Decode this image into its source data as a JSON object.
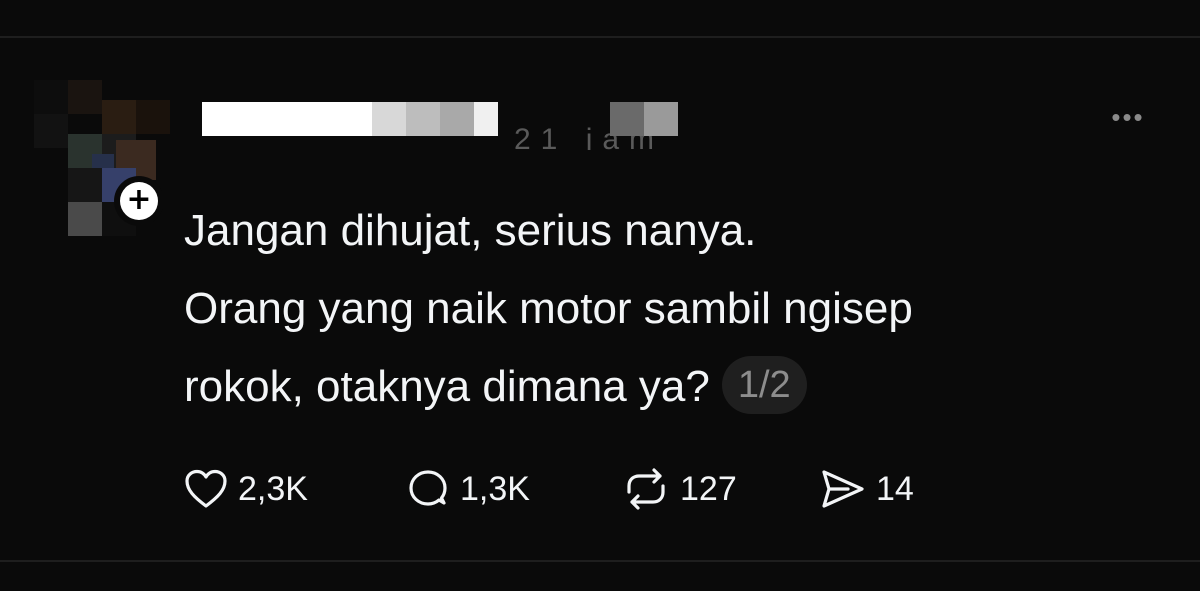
{
  "post": {
    "lines": [
      "Jangan dihujat, serius nanya.",
      "Orang yang naik motor sambil ngisep",
      "rokok, otaknya dimana ya?"
    ],
    "page_indicator": "1/2"
  },
  "author": {
    "follow_symbol": "+"
  },
  "menu": {
    "more_symbol": "•••"
  },
  "actions": {
    "like": {
      "icon": "heart-icon",
      "count": "2,3K"
    },
    "reply": {
      "icon": "comment-icon",
      "count": "1,3K"
    },
    "repost": {
      "icon": "repost-icon",
      "count": "127"
    },
    "share": {
      "icon": "send-icon",
      "count": "14"
    }
  },
  "colors": {
    "background": "#0a0a0a",
    "text": "#f3f5f7",
    "muted": "#8d8d8d",
    "pill_bg": "#1f1f1f"
  }
}
